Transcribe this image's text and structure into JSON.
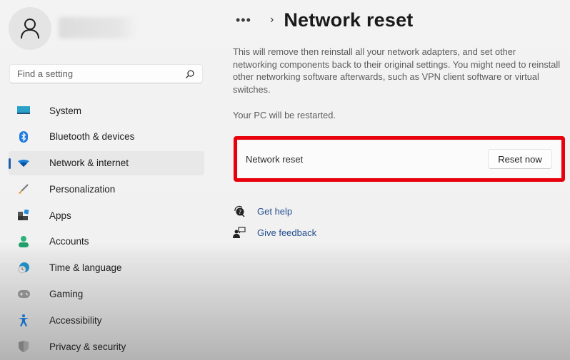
{
  "sidebar": {
    "search": {
      "placeholder": "Find a setting",
      "value": ""
    },
    "items": [
      {
        "label": "System",
        "icon": "monitor-icon",
        "active": false
      },
      {
        "label": "Bluetooth & devices",
        "icon": "bluetooth-icon",
        "active": false
      },
      {
        "label": "Network & internet",
        "icon": "wifi-icon",
        "active": true
      },
      {
        "label": "Personalization",
        "icon": "brush-icon",
        "active": false
      },
      {
        "label": "Apps",
        "icon": "apps-icon",
        "active": false
      },
      {
        "label": "Accounts",
        "icon": "person-icon",
        "active": false
      },
      {
        "label": "Time & language",
        "icon": "globe-clock-icon",
        "active": false
      },
      {
        "label": "Gaming",
        "icon": "gamepad-icon",
        "active": false
      },
      {
        "label": "Accessibility",
        "icon": "accessibility-icon",
        "active": false
      },
      {
        "label": "Privacy & security",
        "icon": "shield-icon",
        "active": false
      }
    ]
  },
  "header": {
    "overflow_label": "•••",
    "separator": "›",
    "title": "Network reset"
  },
  "main": {
    "description": "This will remove then reinstall all your network adapters, and set other networking components back to their original settings. You might need to reinstall other networking software afterwards, such as VPN client software or virtual switches.",
    "restart_note": "Your PC will be restarted.",
    "card": {
      "label": "Network reset",
      "button_label": "Reset now"
    },
    "links": [
      {
        "label": "Get help",
        "icon": "help-icon"
      },
      {
        "label": "Give feedback",
        "icon": "feedback-icon"
      }
    ]
  },
  "colors": {
    "accent": "#1f5ea8",
    "highlight": "#e8000b",
    "link": "#254f8f"
  }
}
